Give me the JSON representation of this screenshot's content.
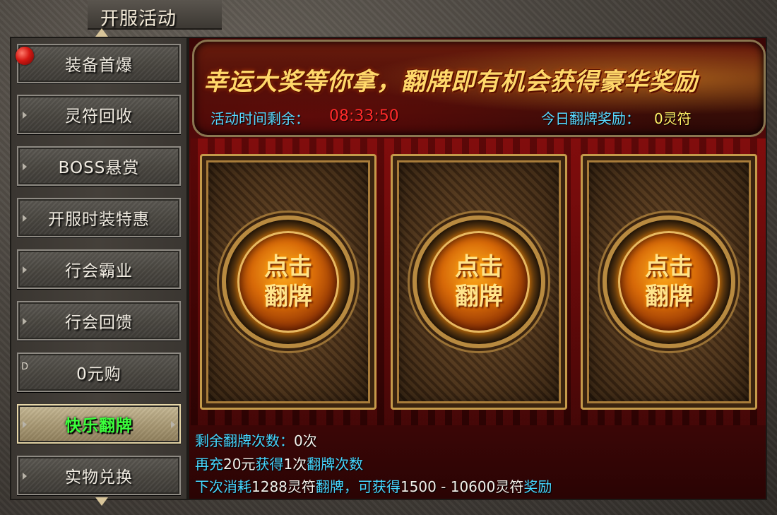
{
  "window": {
    "title": "开服活动"
  },
  "sidebar": {
    "items": [
      {
        "label": "装备首爆"
      },
      {
        "label": "灵符回收"
      },
      {
        "label": "BOSS悬赏"
      },
      {
        "label": "开服时装特惠"
      },
      {
        "label": "行会霸业"
      },
      {
        "label": "行会回馈"
      },
      {
        "label": "0元购"
      },
      {
        "label": "快乐翻牌"
      },
      {
        "label": "实物兑换"
      }
    ],
    "active_index": 7,
    "edge_mark": "D"
  },
  "banner": {
    "slogan": "幸运大奖等你拿，翻牌即有机会获得豪华奖励",
    "time_label": "活动时间剩余：",
    "time_value": "08:33:50",
    "reward_label": "今日翻牌奖励：",
    "reward_value": "0灵符"
  },
  "cards": [
    {
      "line1": "点击",
      "line2": "翻牌"
    },
    {
      "line1": "点击",
      "line2": "翻牌"
    },
    {
      "line1": "点击",
      "line2": "翻牌"
    }
  ],
  "info": {
    "remaining_label": "剩余翻牌次数：",
    "remaining_value": "0次",
    "recharge_prefix": "再充",
    "recharge_amount": "20元",
    "recharge_mid": "获得",
    "recharge_times": "1次",
    "recharge_suffix": "翻牌次数",
    "next_prefix": "下次消耗",
    "next_cost": "1288灵符",
    "next_mid": "翻牌，可获得",
    "next_range": "1500 - 10600灵符",
    "next_suffix": "奖励"
  },
  "colors": {
    "label_cyan": "#46d6ff",
    "timer_red": "#ff2a2a",
    "reward_yellow": "#fff066",
    "active_green": "#3cff3c"
  }
}
